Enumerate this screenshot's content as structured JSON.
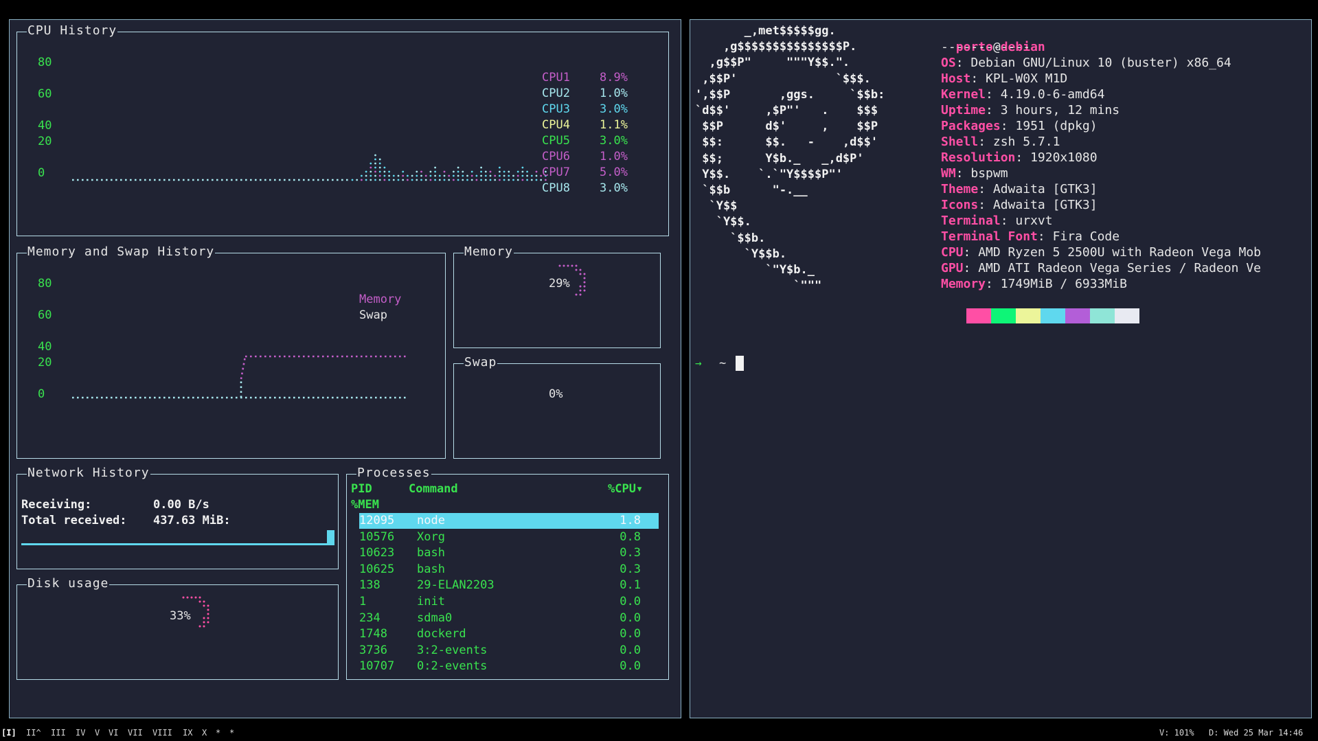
{
  "cpu_panel": {
    "title": "CPU History",
    "y_ticks": [
      "80",
      "60",
      "40",
      "20",
      "0"
    ],
    "cores": [
      {
        "name": "CPU1",
        "value": "8.9%",
        "color": "#c45ec9"
      },
      {
        "name": "CPU2",
        "value": "1.0%",
        "color": "#a7e7ed"
      },
      {
        "name": "CPU3",
        "value": "3.0%",
        "color": "#5fd8ee"
      },
      {
        "name": "CPU4",
        "value": "1.1%",
        "color": "#ecf59a"
      },
      {
        "name": "CPU5",
        "value": "3.0%",
        "color": "#39e34e"
      },
      {
        "name": "CPU6",
        "value": "1.0%",
        "color": "#c45ec9"
      },
      {
        "name": "CPU7",
        "value": "5.0%",
        "color": "#c45ec9"
      },
      {
        "name": "CPU8",
        "value": "3.0%",
        "color": "#a7e7ed"
      }
    ]
  },
  "memswap_panel": {
    "title": "Memory and Swap History",
    "y_ticks": [
      "80",
      "60",
      "40",
      "20",
      "0"
    ],
    "legend": [
      {
        "name": "Memory",
        "color": "#c45ec9"
      },
      {
        "name": "Swap",
        "color": "#e6e6e6"
      }
    ]
  },
  "memory_panel": {
    "title": "Memory",
    "percent": "29%",
    "fraction": 0.29
  },
  "swap_panel": {
    "title": "Swap",
    "percent": "0%",
    "fraction": 0.0
  },
  "network_panel": {
    "title": "Network History",
    "receiving_label": "Receiving:",
    "receiving_value": "0.00 B/s",
    "total_label": "Total received:",
    "total_value": "437.63 MiB:"
  },
  "disk_panel": {
    "title": "Disk usage",
    "percent": "33%",
    "fraction": 0.33
  },
  "processes_panel": {
    "title": "Processes",
    "headers": {
      "pid": "PID",
      "command": "Command",
      "cpu": "%CPU▾",
      "mem": "%MEM"
    },
    "rows": [
      {
        "pid": "12095",
        "command": "node",
        "cpu": "1.8"
      },
      {
        "pid": "10576",
        "command": "Xorg",
        "cpu": "0.8"
      },
      {
        "pid": "10623",
        "command": "bash",
        "cpu": "0.3"
      },
      {
        "pid": "10625",
        "command": "bash",
        "cpu": "0.3"
      },
      {
        "pid": "138",
        "command": "29-ELAN2203",
        "cpu": "0.1"
      },
      {
        "pid": "1",
        "command": "init",
        "cpu": "0.0"
      },
      {
        "pid": "234",
        "command": "sdma0",
        "cpu": "0.0"
      },
      {
        "pid": "1748",
        "command": "dockerd",
        "cpu": "0.0"
      },
      {
        "pid": "3736",
        "command": "3:2-events",
        "cpu": "0.0"
      },
      {
        "pid": "10707",
        "command": "0:2-events",
        "cpu": "0.0"
      }
    ]
  },
  "neofetch": {
    "user": "porto",
    "at": "@",
    "host": "debian",
    "separator": "------------",
    "info": [
      {
        "key": "OS",
        "value": "Debian GNU/Linux 10 (buster) x86_64"
      },
      {
        "key": "Host",
        "value": "KPL-W0X M1D"
      },
      {
        "key": "Kernel",
        "value": "4.19.0-6-amd64"
      },
      {
        "key": "Uptime",
        "value": "3 hours, 12 mins"
      },
      {
        "key": "Packages",
        "value": "1951 (dpkg)"
      },
      {
        "key": "Shell",
        "value": "zsh 5.7.1"
      },
      {
        "key": "Resolution",
        "value": "1920x1080"
      },
      {
        "key": "WM",
        "value": "bspwm"
      },
      {
        "key": "Theme",
        "value": "Adwaita [GTK3]"
      },
      {
        "key": "Icons",
        "value": "Adwaita [GTK3]"
      },
      {
        "key": "Terminal",
        "value": "urxvt"
      },
      {
        "key": "Terminal Font",
        "value": "Fira Code"
      },
      {
        "key": "CPU",
        "value": "AMD Ryzen 5 2500U with Radeon Vega Mob"
      },
      {
        "key": "GPU",
        "value": "AMD ATI Radeon Vega Series / Radeon Ve"
      },
      {
        "key": "Memory",
        "value": "1749MiB / 6933MiB"
      }
    ],
    "ascii_art": "       _,met$$$$$gg.\n    ,g$$$$$$$$$$$$$$$P.\n  ,g$$P\"     \"\"\"Y$$.\".\n ,$$P'              `$$$.\n',$$P       ,ggs.     `$$b:\n`d$$'     ,$P\"'   .    $$$\n $$P      d$'     ,    $$P\n $$:      $$.   -    ,d$$'\n $$;      Y$b._   _,d$P'\n Y$$.    `.`\"Y$$$$P\"'\n `$$b      \"-.__\n  `Y$$\n   `Y$$.\n     `$$b.\n       `Y$$b.\n          `\"Y$b._\n              `\"\"\"",
    "palette": [
      "#ff4fa5",
      "#0ef577",
      "#ecf59a",
      "#5fd8ee",
      "#b35ed8",
      "#8fe5d7",
      "#e8eaf2"
    ]
  },
  "prompt": {
    "arrow": "→",
    "dir": "~"
  },
  "statusbar": {
    "workspaces": [
      "[I]",
      "II^",
      "III",
      "IV",
      "V",
      "VI",
      "VII",
      "VIII",
      "IX",
      "X",
      "*",
      "*"
    ],
    "volume": "V: 101%",
    "date": "D: Wed 25 Mar 14:46"
  }
}
